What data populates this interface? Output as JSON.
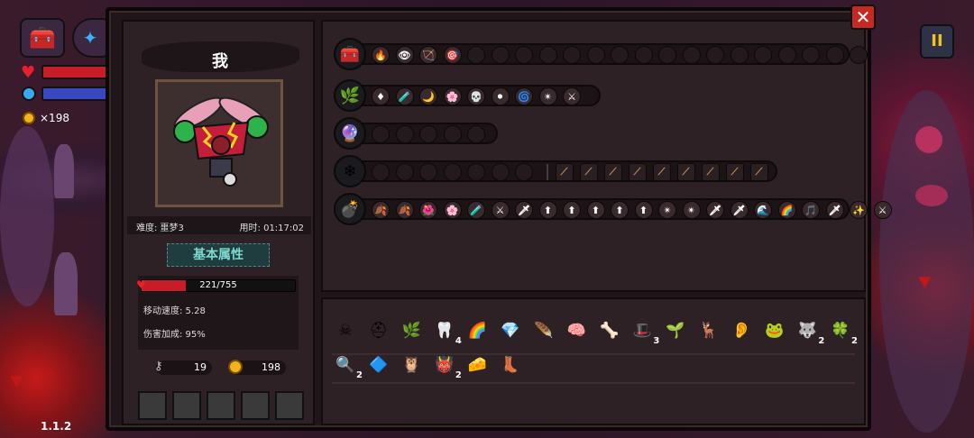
{
  "hud": {
    "coin_count": "×198",
    "version": "1.1.2"
  },
  "panel": {
    "close_label": "✕",
    "pause_label": "II"
  },
  "character": {
    "name": "我",
    "difficulty": "难度: 噩梦3",
    "time": "用时: 01:17:02",
    "section_title": "基本属性",
    "hp": "221/755",
    "hp_fraction": 0.29,
    "move_speed": "移动速度: 5.28",
    "damage_bonus": "伤害加成: 95%",
    "keys": "19",
    "coins": "198"
  },
  "colors": {
    "hp": "#c81d28",
    "mana": "#3a48c0",
    "accent": "#7ed8d0"
  },
  "rows": [
    {
      "icon": "treasure-chest-icon",
      "filled": [
        "🔥",
        "👁",
        "🏹",
        "🎯"
      ],
      "empty": 17
    },
    {
      "icon": "green-staff-icon",
      "filled": [
        "♦",
        "🧪",
        "🌙",
        "🌸",
        "💀",
        "⚫",
        "🌀",
        "✴",
        "⚔"
      ],
      "empty": 0
    },
    {
      "icon": "dark-orb-icon",
      "filled": [],
      "empty": 5
    },
    {
      "icon": "crystal-wand-icon",
      "filled": [],
      "empty": 7,
      "extra": 9
    },
    {
      "icon": "cannon-icon",
      "filled": [
        "🍂",
        "🍂",
        "🌺",
        "🌸",
        "🧪",
        "⚔",
        "🗡",
        "⬆",
        "⬆",
        "⬆",
        "⬆",
        "⬆",
        "✴",
        "✴",
        "🗡",
        "🗡",
        "🌊",
        "🌈",
        "🎵",
        "🗡",
        "✨",
        "⚔"
      ],
      "empty": 0
    }
  ],
  "inventory": {
    "row1": [
      {
        "icon": "skull-mask-icon",
        "glyph": "☠",
        "count": ""
      },
      {
        "icon": "helmet-icon",
        "glyph": "⛑",
        "count": ""
      },
      {
        "icon": "leaf-icon",
        "glyph": "🌿",
        "count": ""
      },
      {
        "icon": "fang-icon",
        "glyph": "🦷",
        "count": "4"
      },
      {
        "icon": "rainbow-icon",
        "glyph": "🌈",
        "count": ""
      },
      {
        "icon": "gem-icon",
        "glyph": "💎",
        "count": ""
      },
      {
        "icon": "feather-icon",
        "glyph": "🪶",
        "count": ""
      },
      {
        "icon": "brain-icon",
        "glyph": "🧠",
        "count": ""
      },
      {
        "icon": "ribcage-icon",
        "glyph": "🦴",
        "count": ""
      },
      {
        "icon": "wizard-hat-icon",
        "glyph": "🎩",
        "count": "3"
      },
      {
        "icon": "sprout-icon",
        "glyph": "🌱",
        "count": ""
      },
      {
        "icon": "antler-icon",
        "glyph": "🦌",
        "count": ""
      },
      {
        "icon": "ear-icon",
        "glyph": "👂",
        "count": ""
      },
      {
        "icon": "frog-icon",
        "glyph": "🐸",
        "count": ""
      },
      {
        "icon": "wolf-icon",
        "glyph": "🐺",
        "count": "2"
      },
      {
        "icon": "clover-icon",
        "glyph": "🍀",
        "count": "2"
      }
    ],
    "row2": [
      {
        "icon": "magnifier-icon",
        "glyph": "🔍",
        "count": "2"
      },
      {
        "icon": "blue-gem-icon",
        "glyph": "🔷",
        "count": ""
      },
      {
        "icon": "owl-icon",
        "glyph": "🦉",
        "count": ""
      },
      {
        "icon": "demon-icon",
        "glyph": "👹",
        "count": "2"
      },
      {
        "icon": "cheese-icon",
        "glyph": "🧀",
        "count": ""
      },
      {
        "icon": "boot-icon",
        "glyph": "👢",
        "count": ""
      }
    ]
  }
}
